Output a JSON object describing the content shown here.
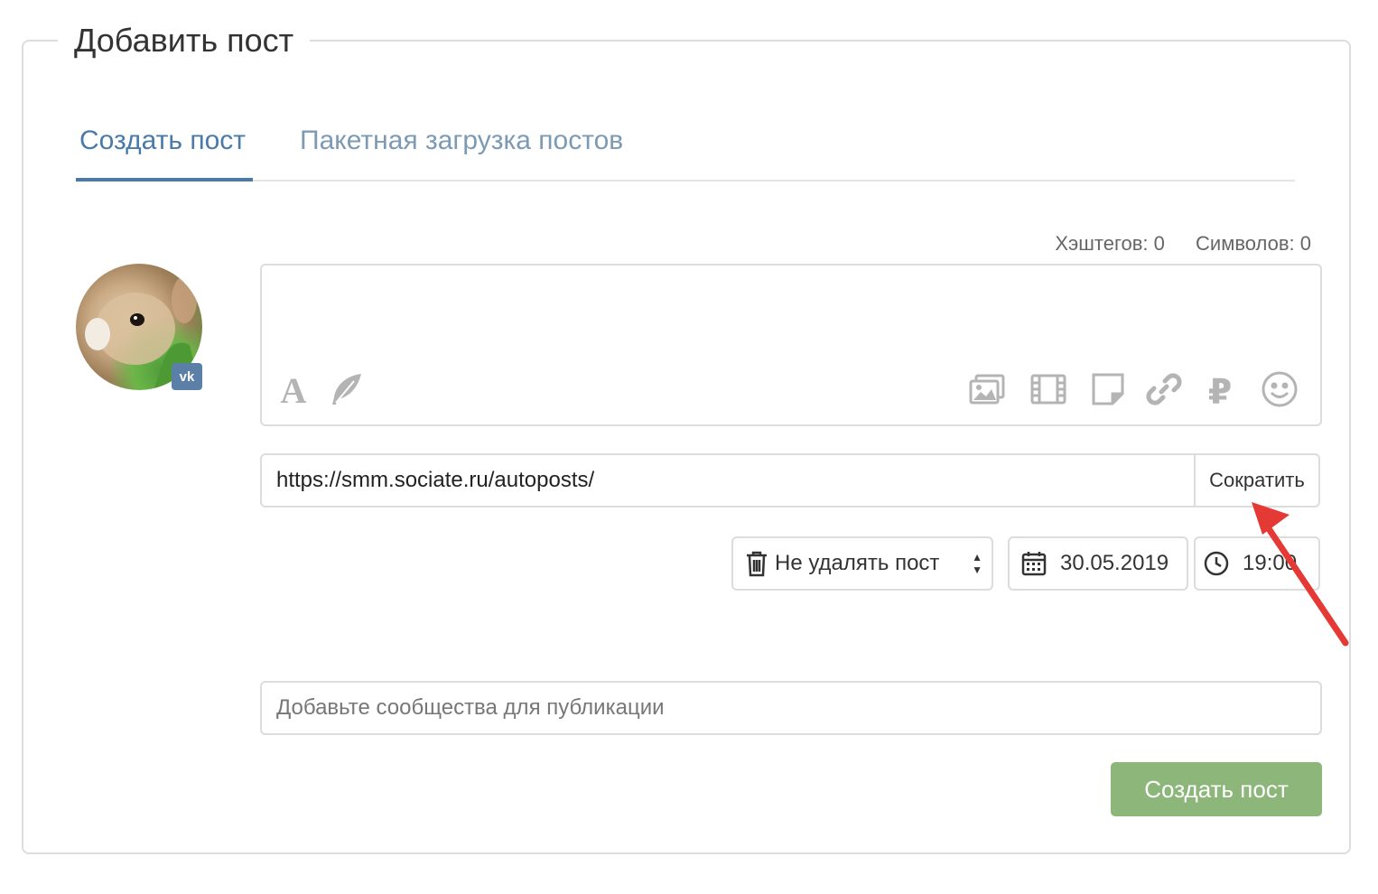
{
  "panel": {
    "title": "Добавить пост"
  },
  "tabs": [
    {
      "label": "Создать пост",
      "active": true
    },
    {
      "label": "Пакетная загрузка постов",
      "active": false
    }
  ],
  "counters": {
    "hashtags": "Хэштегов: 0",
    "symbols": "Символов: 0"
  },
  "avatar": {
    "network_badge": "vk"
  },
  "toolbar": {
    "left": [
      "font-icon",
      "feather-icon"
    ],
    "right": [
      "images-icon",
      "video-icon",
      "note-icon",
      "link-icon",
      "ruble-icon",
      "smiley-icon"
    ]
  },
  "url": {
    "value": "https://smm.sociate.ru/autoposts/",
    "shorten_label": "Сократить"
  },
  "schedule": {
    "delete_option": "Не удалять пост",
    "date": "30.05.2019",
    "time": "19:00"
  },
  "communities": {
    "placeholder": "Добавьте сообщества для публикации"
  },
  "submit": {
    "label": "Создать пост"
  },
  "colors": {
    "accent": "#4a7aaa",
    "submit": "#8db77a",
    "annotation_arrow": "#e53935",
    "icon_gray": "#b4b4b4"
  }
}
